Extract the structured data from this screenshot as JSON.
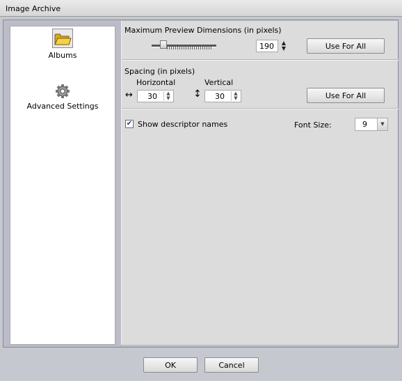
{
  "window": {
    "title": "Image Archive"
  },
  "sidebar": {
    "items": [
      {
        "label": "Albums",
        "icon": "folder-icon"
      },
      {
        "label": "Advanced Settings",
        "icon": "gear-icon"
      }
    ]
  },
  "preview": {
    "heading": "Maximum Preview Dimensions (in pixels)",
    "value": "190",
    "slider_fraction": 0.15,
    "use_for_all_label": "Use For All"
  },
  "spacing": {
    "heading": "Spacing (in pixels)",
    "horizontal_label": "Horizontal",
    "horizontal_value": "30",
    "vertical_label": "Vertical",
    "vertical_value": "30",
    "use_for_all_label": "Use For All"
  },
  "descriptor": {
    "checkbox_label": "Show descriptor names",
    "checked": true,
    "font_size_label": "Font Size:",
    "font_size_value": "9"
  },
  "footer": {
    "ok_label": "OK",
    "cancel_label": "Cancel"
  }
}
